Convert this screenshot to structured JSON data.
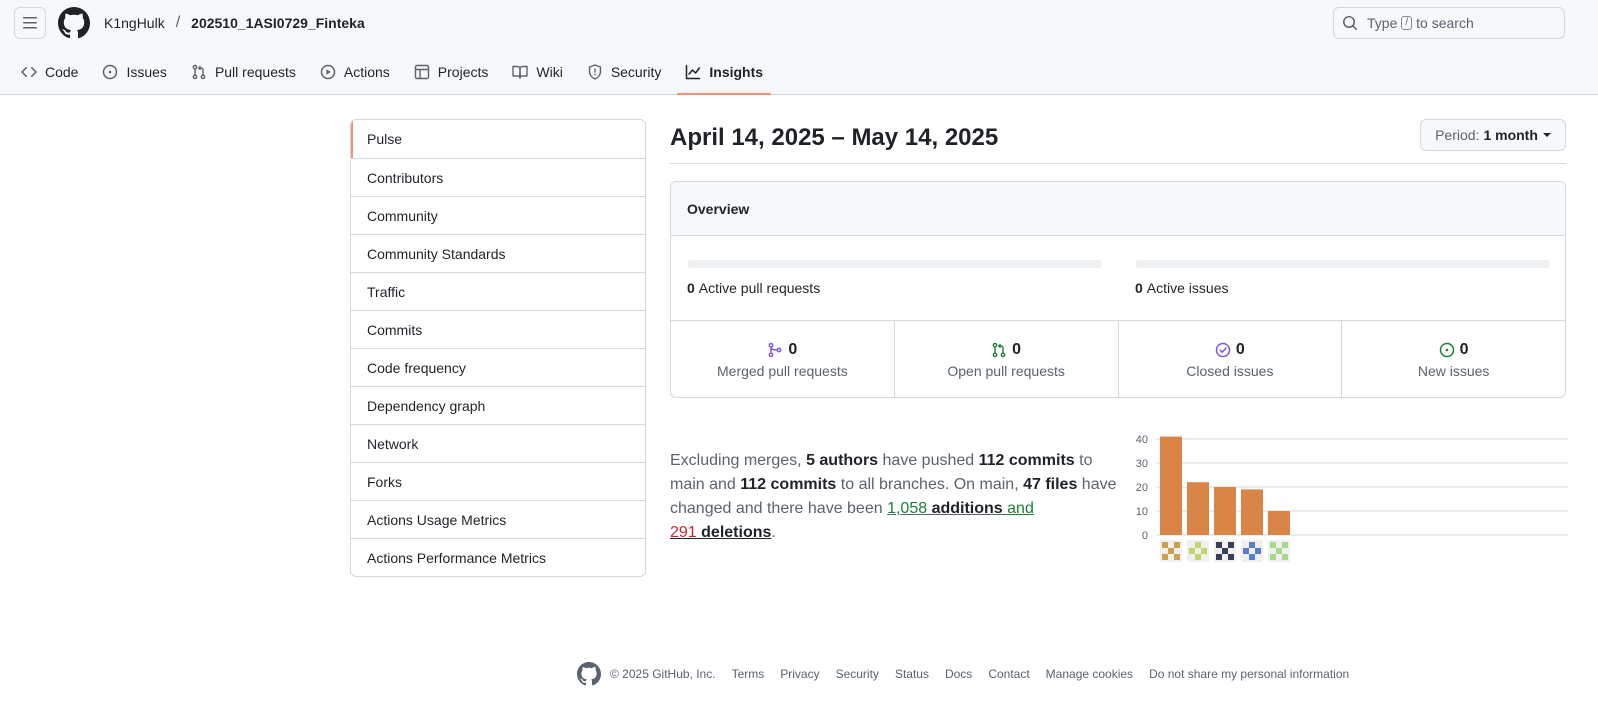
{
  "header": {
    "owner": "K1ngHulk",
    "separator": "/",
    "repo": "202510_1ASI0729_Finteka",
    "search": {
      "before": "Type",
      "key": "/",
      "after": "to search"
    }
  },
  "tabs": [
    {
      "label": "Code",
      "icon": "code-icon"
    },
    {
      "label": "Issues",
      "icon": "issue-opened-icon"
    },
    {
      "label": "Pull requests",
      "icon": "git-pull-request-icon"
    },
    {
      "label": "Actions",
      "icon": "play-icon"
    },
    {
      "label": "Projects",
      "icon": "table-icon"
    },
    {
      "label": "Wiki",
      "icon": "book-icon"
    },
    {
      "label": "Security",
      "icon": "shield-icon"
    },
    {
      "label": "Insights",
      "icon": "graph-icon",
      "active": true
    }
  ],
  "sidebar": {
    "items": [
      "Pulse",
      "Contributors",
      "Community",
      "Community Standards",
      "Traffic",
      "Commits",
      "Code frequency",
      "Dependency graph",
      "Network",
      "Forks",
      "Actions Usage Metrics",
      "Actions Performance Metrics"
    ],
    "selected": "Pulse"
  },
  "pulse": {
    "date_range": "April 14, 2025 – May 14, 2025",
    "period_label": "Period:",
    "period_value": "1 month"
  },
  "overview": {
    "title": "Overview",
    "active_prs": {
      "count": "0",
      "label": "Active pull requests",
      "fill": 0
    },
    "active_issues": {
      "count": "0",
      "label": "Active issues",
      "fill": 0
    },
    "merged_prs": {
      "count": "0",
      "label": "Merged pull requests",
      "color": "#8250df"
    },
    "open_prs": {
      "count": "0",
      "label": "Open pull requests",
      "color": "#1a7f37"
    },
    "closed_issues": {
      "count": "0",
      "label": "Closed issues",
      "color": "#8250df"
    },
    "new_issues": {
      "count": "0",
      "label": "New issues",
      "color": "#1a7f37"
    }
  },
  "summary": {
    "t1": "Excluding merges, ",
    "authors": "5 authors",
    "t2": " have pushed ",
    "commits_main": "112 commits",
    "t3": " to main and ",
    "commits_all": "112 commits",
    "t4": " to all branches. On main, ",
    "files": "47 files",
    "t5": " have changed and there have been ",
    "additions_num": "1,058",
    "additions_word": "additions",
    "t6": "and",
    "deletions_num": "291",
    "deletions_word": "deletions",
    "t7": "."
  },
  "chart_data": {
    "type": "bar",
    "categories": [
      "author-1",
      "author-2",
      "author-3",
      "author-4",
      "author-5"
    ],
    "values": [
      41,
      22,
      20,
      19,
      10
    ],
    "ylim": [
      0,
      40
    ],
    "yticks": [
      0,
      10,
      20,
      30,
      40
    ],
    "bar_color": "#da8548",
    "grid": true,
    "avatar_colors": [
      "#c9a24b",
      "#c5d36a",
      "#3a3f58",
      "#5a7bd4",
      "#a6d88a"
    ]
  },
  "footer": {
    "copyright": "© 2025 GitHub, Inc.",
    "links": [
      "Terms",
      "Privacy",
      "Security",
      "Status",
      "Docs",
      "Contact",
      "Manage cookies",
      "Do not share my personal information"
    ]
  }
}
